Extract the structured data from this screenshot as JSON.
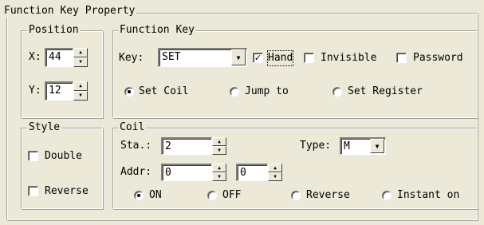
{
  "title": "Function Key Property",
  "position": {
    "legend": "Position",
    "x_label": "X:",
    "x_value": "44",
    "y_label": "Y:",
    "y_value": "12"
  },
  "function_key": {
    "legend": "Function Key",
    "key_label": "Key:",
    "key_value": "SET",
    "hand_label": "Hand",
    "hand_checked": true,
    "invisible_label": "Invisible",
    "password_label": "Password",
    "radios": [
      {
        "label": "Set Coil",
        "selected": true
      },
      {
        "label": "Jump to",
        "selected": false
      },
      {
        "label": "Set Register",
        "selected": false
      }
    ]
  },
  "style": {
    "legend": "Style",
    "double_label": "Double",
    "reverse_label": "Reverse"
  },
  "coil": {
    "legend": "Coil",
    "sta_label": "Sta.:",
    "sta_value": "2",
    "type_label": "Type:",
    "type_value": "M",
    "addr_label": "Addr:",
    "addr_value1": "0",
    "addr_value2": "0",
    "radios": [
      {
        "label": "ON",
        "selected": true
      },
      {
        "label": "OFF",
        "selected": false
      },
      {
        "label": "Reverse",
        "selected": false
      },
      {
        "label": "Instant on",
        "selected": false
      }
    ]
  }
}
